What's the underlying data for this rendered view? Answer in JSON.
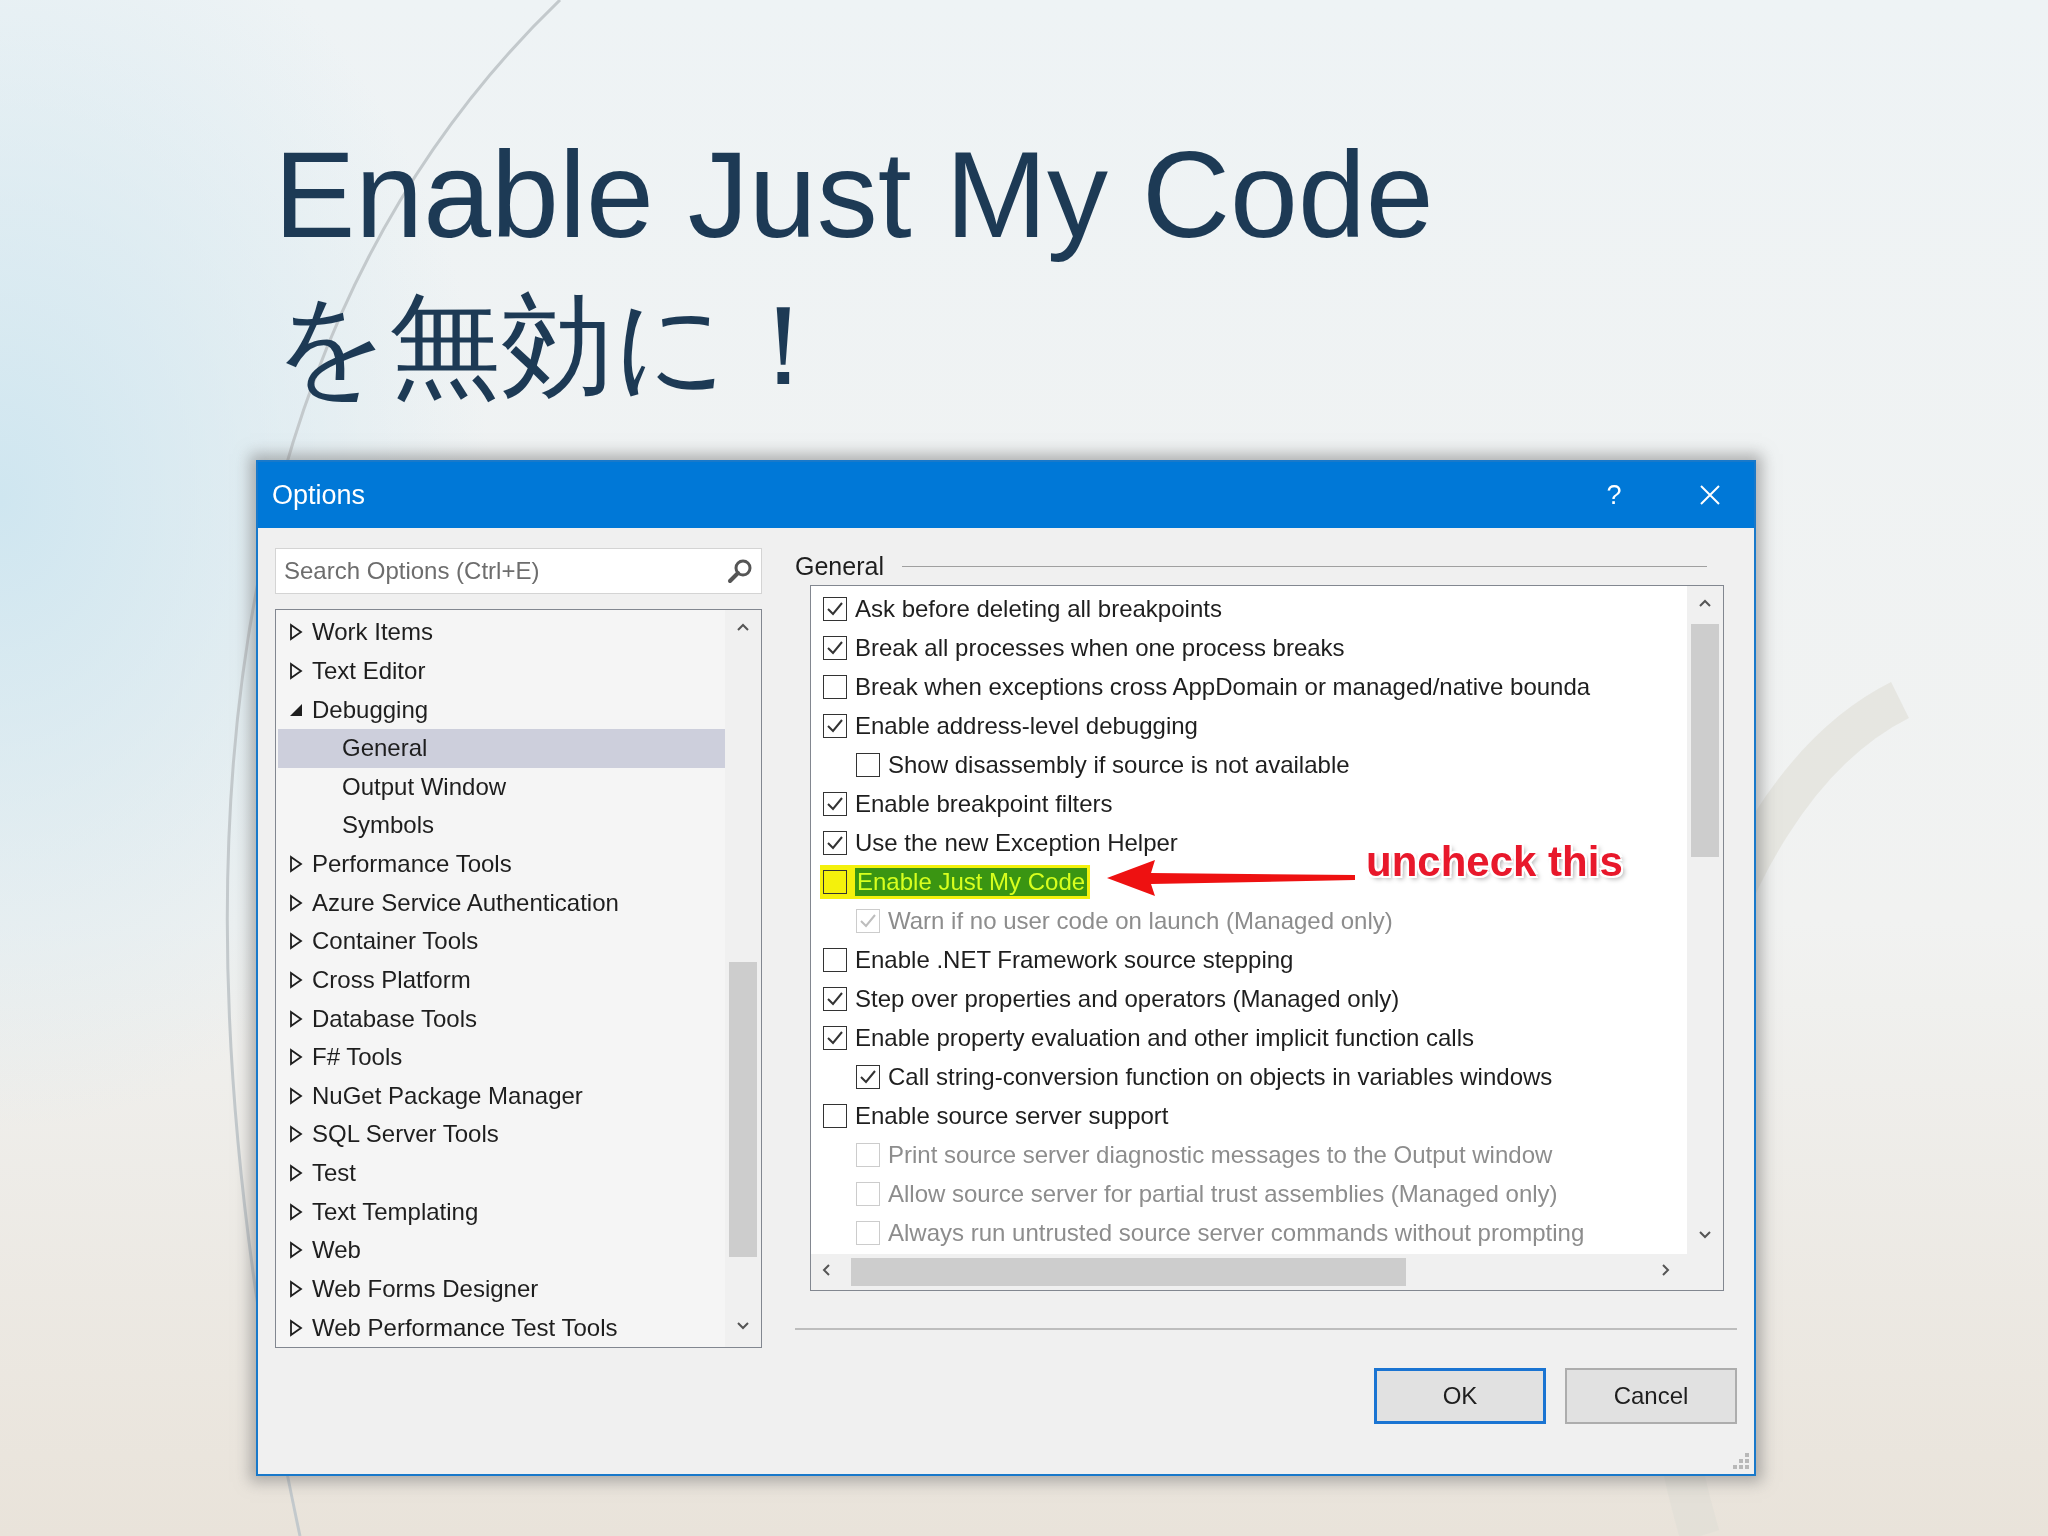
{
  "slide": {
    "title_lines": [
      "Enable Just My Code",
      "を無効に！"
    ]
  },
  "dialog": {
    "title": "Options",
    "help": "?",
    "search": {
      "placeholder": "Search Options (Ctrl+E)"
    },
    "tree": [
      {
        "label": "Work Items",
        "expanded": false,
        "selected": false
      },
      {
        "label": "Text Editor",
        "expanded": false,
        "selected": false
      },
      {
        "label": "Debugging",
        "expanded": true,
        "selected": false,
        "children": [
          {
            "label": "General",
            "selected": true
          },
          {
            "label": "Output Window",
            "selected": false
          },
          {
            "label": "Symbols",
            "selected": false
          }
        ]
      },
      {
        "label": "Performance Tools",
        "expanded": false,
        "selected": false
      },
      {
        "label": "Azure Service Authentication",
        "expanded": false,
        "selected": false
      },
      {
        "label": "Container Tools",
        "expanded": false,
        "selected": false
      },
      {
        "label": "Cross Platform",
        "expanded": false,
        "selected": false
      },
      {
        "label": "Database Tools",
        "expanded": false,
        "selected": false
      },
      {
        "label": "F# Tools",
        "expanded": false,
        "selected": false
      },
      {
        "label": "NuGet Package Manager",
        "expanded": false,
        "selected": false
      },
      {
        "label": "SQL Server Tools",
        "expanded": false,
        "selected": false
      },
      {
        "label": "Test",
        "expanded": false,
        "selected": false
      },
      {
        "label": "Text Templating",
        "expanded": false,
        "selected": false
      },
      {
        "label": "Web",
        "expanded": false,
        "selected": false
      },
      {
        "label": "Web Forms Designer",
        "expanded": false,
        "selected": false
      },
      {
        "label": "Web Performance Test Tools",
        "expanded": false,
        "selected": false
      }
    ],
    "section_title": "General",
    "settings": [
      {
        "label": "Ask before deleting all breakpoints",
        "checked": true,
        "disabled": false,
        "highlighted": false
      },
      {
        "label": "Break all processes when one process breaks",
        "checked": true,
        "disabled": false,
        "highlighted": false
      },
      {
        "label": "Break when exceptions cross AppDomain or managed/native bounda",
        "checked": false,
        "disabled": false,
        "highlighted": false
      },
      {
        "label": "Enable address-level debugging",
        "checked": true,
        "disabled": false,
        "highlighted": false,
        "children": [
          {
            "label": "Show disassembly if source is not available",
            "checked": false,
            "disabled": false,
            "highlighted": false
          }
        ]
      },
      {
        "label": "Enable breakpoint filters",
        "checked": true,
        "disabled": false,
        "highlighted": false
      },
      {
        "label": "Use the new Exception Helper",
        "checked": true,
        "disabled": false,
        "highlighted": false
      },
      {
        "label": "Enable Just My Code",
        "checked": false,
        "disabled": false,
        "highlighted": true,
        "children": [
          {
            "label": "Warn if no user code on launch (Managed only)",
            "checked": true,
            "disabled": true,
            "highlighted": false
          }
        ]
      },
      {
        "label": "Enable .NET Framework source stepping",
        "checked": false,
        "disabled": false,
        "highlighted": false
      },
      {
        "label": "Step over properties and operators (Managed only)",
        "checked": true,
        "disabled": false,
        "highlighted": false
      },
      {
        "label": "Enable property evaluation and other implicit function calls",
        "checked": true,
        "disabled": false,
        "highlighted": false,
        "children": [
          {
            "label": "Call string-conversion function on objects in variables windows",
            "checked": true,
            "disabled": false,
            "highlighted": false
          }
        ]
      },
      {
        "label": "Enable source server support",
        "checked": false,
        "disabled": false,
        "highlighted": false,
        "children": [
          {
            "label": "Print source server diagnostic messages to the Output window",
            "checked": false,
            "disabled": true,
            "highlighted": false
          },
          {
            "label": "Allow source server for partial trust assemblies (Managed only)",
            "checked": false,
            "disabled": true,
            "highlighted": false
          },
          {
            "label": "Always run untrusted source server commands without prompting",
            "checked": false,
            "disabled": true,
            "highlighted": false
          }
        ]
      }
    ],
    "annotation": {
      "text": "uncheck this"
    },
    "buttons": [
      {
        "label": "OK",
        "default": true
      },
      {
        "label": "Cancel",
        "default": false
      }
    ]
  }
}
